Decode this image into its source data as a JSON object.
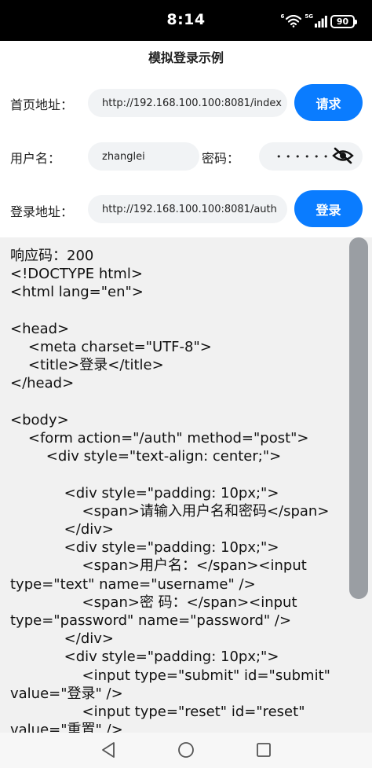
{
  "status_bar": {
    "time": "8:14",
    "wifi_sup": "6",
    "network": "5G",
    "battery": "90"
  },
  "page": {
    "title": "模拟登录示例"
  },
  "form": {
    "home_label": "首页地址：",
    "home_url": "http://192.168.100.100:8081/index",
    "request_button": "请求",
    "username_label": "用户名：",
    "username_value": "zhanglei",
    "password_label": "密码：",
    "password_mask": "• • • • • •",
    "login_label": "登录地址：",
    "login_url": "http://192.168.100.100:8081/auth",
    "login_button": "登录"
  },
  "response": {
    "text": "响应码：200\n<!DOCTYPE html>\n<html lang=\"en\">\n\n<head>\n    <meta charset=\"UTF-8\">\n    <title>登录</title>\n</head>\n\n<body>\n    <form action=\"/auth\" method=\"post\">\n        <div style=\"text-align: center;\">\n\n            <div style=\"padding: 10px;\">\n                <span>请输入用户名和密码</span>\n            </div>\n            <div style=\"padding: 10px;\">\n                <span>用户名：</span><input type=\"text\" name=\"username\" />\n                <span>密 码：</span><input type=\"password\" name=\"password\" />\n            </div>\n            <div style=\"padding: 10px;\">\n                <input type=\"submit\" id=\"submit\" value=\"登录\" />\n                <input type=\"reset\" id=\"reset\" value=\"重置\" />"
  },
  "icons": {
    "eye": "eye-off-icon",
    "wifi": "wifi-icon",
    "signal": "signal-icon",
    "back": "back-triangle-icon",
    "home": "home-circle-icon",
    "recents": "recents-square-icon"
  },
  "colors": {
    "accent": "#0a7cff",
    "field_bg": "#f1f3f5",
    "response_bg": "#f1f1f1"
  }
}
